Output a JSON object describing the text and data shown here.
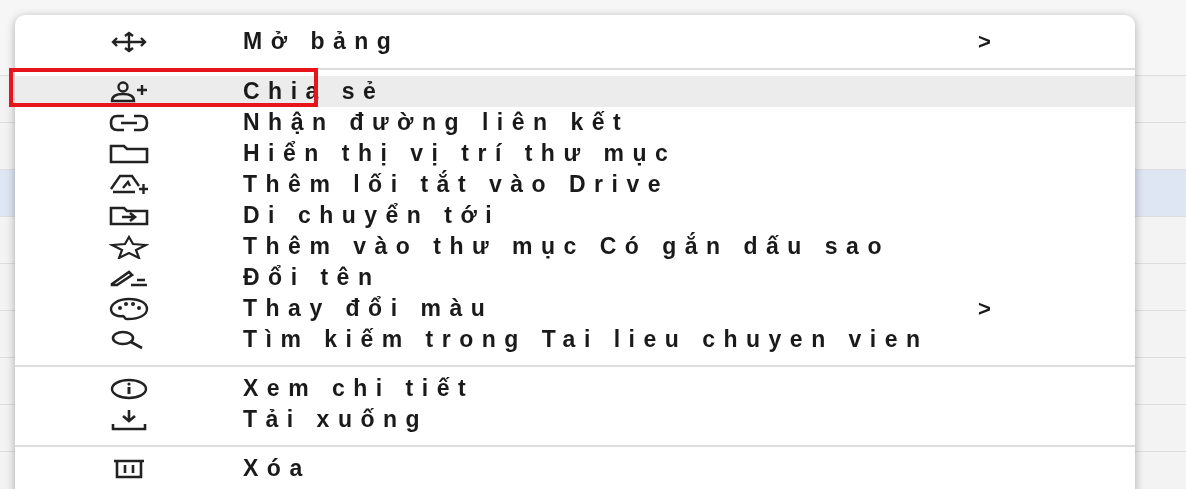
{
  "background_rows": [
    {
      "selected": false
    },
    {
      "selected": false
    },
    {
      "selected": true
    },
    {
      "selected": false
    },
    {
      "selected": false
    },
    {
      "selected": false
    },
    {
      "selected": false
    },
    {
      "selected": false
    },
    {
      "selected": false
    }
  ],
  "context_menu": {
    "groups": [
      {
        "items": [
          {
            "kind": "move",
            "label": "Mở bảng",
            "submenu": true,
            "selected": false,
            "annotated": false
          }
        ]
      },
      {
        "items": [
          {
            "kind": "share",
            "label": "Chia sẻ",
            "submenu": false,
            "selected": true,
            "annotated": true
          },
          {
            "kind": "link",
            "label": "Nhận đường liên kết",
            "submenu": false,
            "selected": false,
            "annotated": false
          },
          {
            "kind": "folder",
            "label": "Hiển thị vị trí thư mục",
            "submenu": false,
            "selected": false,
            "annotated": false
          },
          {
            "kind": "shortcut",
            "label": "Thêm lối tắt vào Drive",
            "submenu": false,
            "selected": false,
            "annotated": false
          },
          {
            "kind": "move_to",
            "label": "Di chuyển tới",
            "submenu": false,
            "selected": false,
            "annotated": false
          },
          {
            "kind": "star",
            "label": "Thêm vào thư mục Có gắn dấu sao",
            "submenu": false,
            "selected": false,
            "annotated": false
          },
          {
            "kind": "rename",
            "label": "Đổi tên",
            "submenu": false,
            "selected": false,
            "annotated": false
          },
          {
            "kind": "palette",
            "label": "Thay đổi màu",
            "submenu": true,
            "selected": false,
            "annotated": false
          },
          {
            "kind": "search",
            "label": "Tìm kiếm trong Tai lieu chuyen vien",
            "submenu": false,
            "selected": false,
            "annotated": false
          }
        ]
      },
      {
        "items": [
          {
            "kind": "info",
            "label": "Xem chi tiết",
            "submenu": false,
            "selected": false,
            "annotated": false
          },
          {
            "kind": "download",
            "label": "Tải xuống",
            "submenu": false,
            "selected": false,
            "annotated": false
          }
        ]
      },
      {
        "items": [
          {
            "kind": "trash",
            "label": "Xóa",
            "submenu": false,
            "selected": false,
            "annotated": false
          }
        ]
      }
    ],
    "submenu_mark": ">"
  }
}
